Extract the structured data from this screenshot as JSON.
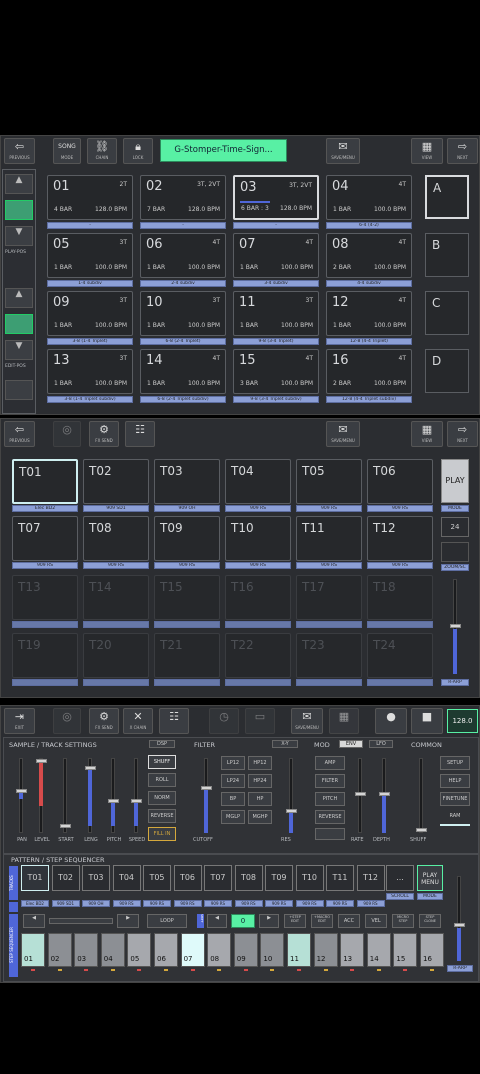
{
  "toolbar1": {
    "previous": "PREVIOUS",
    "mode": "MODE",
    "chain": "CHAIN",
    "lock": "LOCK",
    "title": "G-Stomper-Time-Sign...",
    "save_menu": "SAVE/MENU",
    "view": "VIEW",
    "next": "NEXT"
  },
  "sidebar1": {
    "play_pos": "PLAY-POS",
    "edit_pos": "EDIT-POS"
  },
  "patterns": [
    {
      "num": "01",
      "top": "2T",
      "bars": "4 BAR",
      "bpm": "128.0 BPM",
      "sub": "-"
    },
    {
      "num": "02",
      "top": "3T, 2VT",
      "bars": "7 BAR",
      "bpm": "128.0 BPM",
      "sub": "-"
    },
    {
      "num": "03",
      "top": "3T, 2VT",
      "bars": "6 BAR : 3",
      "bpm": "128.0 BPM",
      "sub": "-"
    },
    {
      "num": "04",
      "top": "4T",
      "bars": "1 BAR",
      "bpm": "100.0 BPM",
      "sub": "6-4 (4-2)"
    },
    {
      "num": "05",
      "top": "3T",
      "bars": "1 BAR",
      "bpm": "100.0 BPM",
      "sub": "1-4 subdiv"
    },
    {
      "num": "06",
      "top": "4T",
      "bars": "1 BAR",
      "bpm": "100.0 BPM",
      "sub": "2-4 subdiv"
    },
    {
      "num": "07",
      "top": "4T",
      "bars": "1 BAR",
      "bpm": "100.0 BPM",
      "sub": "3-4 subdiv"
    },
    {
      "num": "08",
      "top": "4T",
      "bars": "2 BAR",
      "bpm": "100.0 BPM",
      "sub": "4-4 subdiv"
    },
    {
      "num": "09",
      "top": "3T",
      "bars": "1 BAR",
      "bpm": "100.0 BPM",
      "sub": "3-8 (1-4 Triplet)"
    },
    {
      "num": "10",
      "top": "3T",
      "bars": "1 BAR",
      "bpm": "100.0 BPM",
      "sub": "6-8 (2-4 Triplet)"
    },
    {
      "num": "11",
      "top": "3T",
      "bars": "1 BAR",
      "bpm": "100.0 BPM",
      "sub": "9-8 (3-4 Triplet)"
    },
    {
      "num": "12",
      "top": "4T",
      "bars": "1 BAR",
      "bpm": "100.0 BPM",
      "sub": "12-8 (4-4 Triplet)"
    },
    {
      "num": "13",
      "top": "3T",
      "bars": "1 BAR",
      "bpm": "100.0 BPM",
      "sub": "3-8 (1-4 Triplet subdiv)"
    },
    {
      "num": "14",
      "top": "4T",
      "bars": "1 BAR",
      "bpm": "100.0 BPM",
      "sub": "6-8 (2-4 Triplet subdiv)"
    },
    {
      "num": "15",
      "top": "4T",
      "bars": "3 BAR",
      "bpm": "100.0 BPM",
      "sub": "9-8 (3-4 Triplet subdiv)"
    },
    {
      "num": "16",
      "top": "4T",
      "bars": "2 BAR",
      "bpm": "100.0 BPM",
      "sub": "12-8 (4-4 Triplet subdiv)"
    }
  ],
  "banks": [
    "A",
    "B",
    "C",
    "D"
  ],
  "toolbar2": {
    "previous": "PREVIOUS",
    "fx_send": "FX SEND",
    "save_menu": "SAVE/MENU",
    "view": "VIEW",
    "next": "NEXT"
  },
  "tracks": [
    {
      "name": "T01",
      "sub": "Elec BD2"
    },
    {
      "name": "T02",
      "sub": "909 SD1"
    },
    {
      "name": "T03",
      "sub": "909 OH"
    },
    {
      "name": "T04",
      "sub": "909 RS"
    },
    {
      "name": "T05",
      "sub": "909 RS"
    },
    {
      "name": "T06",
      "sub": "909 RS"
    },
    {
      "name": "T07",
      "sub": "909 RS"
    },
    {
      "name": "T08",
      "sub": "909 RS"
    },
    {
      "name": "T09",
      "sub": "909 RS"
    },
    {
      "name": "T10",
      "sub": "909 RS"
    },
    {
      "name": "T11",
      "sub": "909 RS"
    },
    {
      "name": "T12",
      "sub": "909 RS"
    },
    {
      "name": "T13",
      "sub": ""
    },
    {
      "name": "T14",
      "sub": ""
    },
    {
      "name": "T15",
      "sub": ""
    },
    {
      "name": "T16",
      "sub": ""
    },
    {
      "name": "T17",
      "sub": ""
    },
    {
      "name": "T18",
      "sub": ""
    },
    {
      "name": "T19",
      "sub": ""
    },
    {
      "name": "T20",
      "sub": ""
    },
    {
      "name": "T21",
      "sub": ""
    },
    {
      "name": "T22",
      "sub": ""
    },
    {
      "name": "T23",
      "sub": ""
    },
    {
      "name": "T24",
      "sub": ""
    }
  ],
  "right2": {
    "play": "PLAY",
    "mode": "MODE",
    "num": "24",
    "zoom": "ZOOM/SC",
    "arp": "R-ARP"
  },
  "toolbar3": {
    "exit": "EXIT",
    "fx_send": "FX SEND",
    "x_chain": "X CHAIN",
    "save_menu": "SAVE/MENU",
    "tempo": "128.0"
  },
  "sections": {
    "sample": "SAMPLE / TRACK SETTINGS",
    "dsp": "DSP",
    "filter": "FILTER",
    "xy": "X-Y",
    "mod": "MOD",
    "env": "ENV",
    "lfo": "LFO",
    "common": "COMMON"
  },
  "sample_labels": [
    "PAN",
    "LEVEL",
    "START",
    "LENG",
    "PITCH",
    "SPEED"
  ],
  "sample_btns": [
    "SHUFF",
    "ROLL",
    "NORM",
    "REVERSE",
    "FILL IN"
  ],
  "filter_btns": [
    "LP12",
    "HP12",
    "LP24",
    "HP24",
    "BP",
    "HP",
    "MGLP",
    "MGHP"
  ],
  "filter_labels": {
    "cutoff": "CUTOFF",
    "res": "RES"
  },
  "mod_btns": [
    "AMP",
    "FILTER",
    "PITCH",
    "REVERSE"
  ],
  "mod_labels": {
    "rate": "RATE",
    "depth": "DEPTH"
  },
  "common_btns": [
    "SETUP",
    "HELP",
    "FINETUNE",
    "RAM"
  ],
  "common_labels": {
    "shuff": "SHUFF"
  },
  "seq": {
    "title": "PATTERN / STEP SEQUENCER",
    "tracks_label": "TRACKS",
    "step_label": "STEP SEQUENCER",
    "scroll": "SCROLL",
    "mode": "MODE",
    "play_menu": "PLAY MENU",
    "arp": "R-ARP",
    "loop": "LOOP",
    "shift": "SHIFT",
    "zero": "0",
    "step_edit": "+STEP EDIT",
    "macro_edit": "+MACRO EDIT",
    "acc": "ACC",
    "vel": "VEL",
    "micro_step": "MICRO STEP",
    "step_clone": "STEP CLONE",
    "more": "..."
  },
  "seq_tracks": [
    {
      "name": "T01",
      "sub": "Elec BD2"
    },
    {
      "name": "T02",
      "sub": "909 SD1"
    },
    {
      "name": "T03",
      "sub": "909 OH"
    },
    {
      "name": "T04",
      "sub": "909 RS"
    },
    {
      "name": "T05",
      "sub": "909 RS"
    },
    {
      "name": "T06",
      "sub": "909 RS"
    },
    {
      "name": "T07",
      "sub": "909 RS"
    },
    {
      "name": "T08",
      "sub": "909 RS"
    },
    {
      "name": "T09",
      "sub": "909 RS"
    },
    {
      "name": "T10",
      "sub": "909 RS"
    },
    {
      "name": "T11",
      "sub": "909 RS"
    },
    {
      "name": "T12",
      "sub": "909 RS"
    }
  ],
  "steps": [
    "01",
    "02",
    "03",
    "04",
    "05",
    "06",
    "07",
    "08",
    "09",
    "10",
    "11",
    "12",
    "13",
    "14",
    "15",
    "16"
  ],
  "colors": {
    "accent": "#58f0a4",
    "cyan": "#cfeff0",
    "sub": "#8c9fd6",
    "bg": "#2b2d31"
  }
}
